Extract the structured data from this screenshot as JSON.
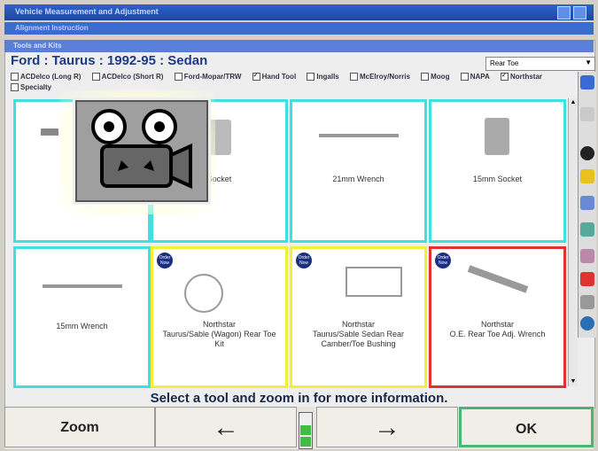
{
  "window": {
    "title": "Vehicle Measurement and Adjustment",
    "subtitle": "Alignment Instruction"
  },
  "section": {
    "title": "Tools and Kits"
  },
  "vehicle": "Ford : Taurus : 1992-95 : Sedan",
  "view_select": {
    "value": "Rear Toe"
  },
  "filters": [
    {
      "label": "ACDelco (Long R)",
      "checked": false
    },
    {
      "label": "ACDelco (Short R)",
      "checked": false
    },
    {
      "label": "Ford-Mopar/TRW",
      "checked": false
    },
    {
      "label": "Hand Tool",
      "checked": true
    },
    {
      "label": "Ingalls",
      "checked": false
    },
    {
      "label": "McElroy/Norris",
      "checked": false
    },
    {
      "label": "Moog",
      "checked": false
    },
    {
      "label": "NAPA",
      "checked": false
    },
    {
      "label": "Northstar",
      "checked": true
    },
    {
      "label": "Specialty",
      "checked": false
    }
  ],
  "tools": [
    {
      "label": "",
      "border": "cyan"
    },
    {
      "label": "Socket",
      "border": "cyan"
    },
    {
      "label": "21mm Wrench",
      "border": "cyan"
    },
    {
      "label": "15mm Socket",
      "border": "cyan"
    },
    {
      "label": "15mm Wrench",
      "border": "cyan"
    },
    {
      "label": "Northstar\nTaurus/Sable (Wagon) Rear Toe Kit",
      "border": "yellow",
      "badge": "Order Now"
    },
    {
      "label": "Northstar\nTaurus/Sable Sedan Rear Camber/Toe Bushing",
      "border": "yellow",
      "badge": "Order Now"
    },
    {
      "label": "Northstar\nO.E. Rear Toe Adj. Wrench",
      "border": "red",
      "badge": "Order Now"
    }
  ],
  "hint": "Select a tool and zoom in for more information.",
  "buttons": {
    "zoom": "Zoom",
    "prev": "←",
    "next": "→",
    "ok": "OK"
  },
  "colors": {
    "cyan": "#3fe0e0",
    "yellow": "#f2ef39",
    "red": "#e33030",
    "ok_border": "#4ab86a"
  }
}
